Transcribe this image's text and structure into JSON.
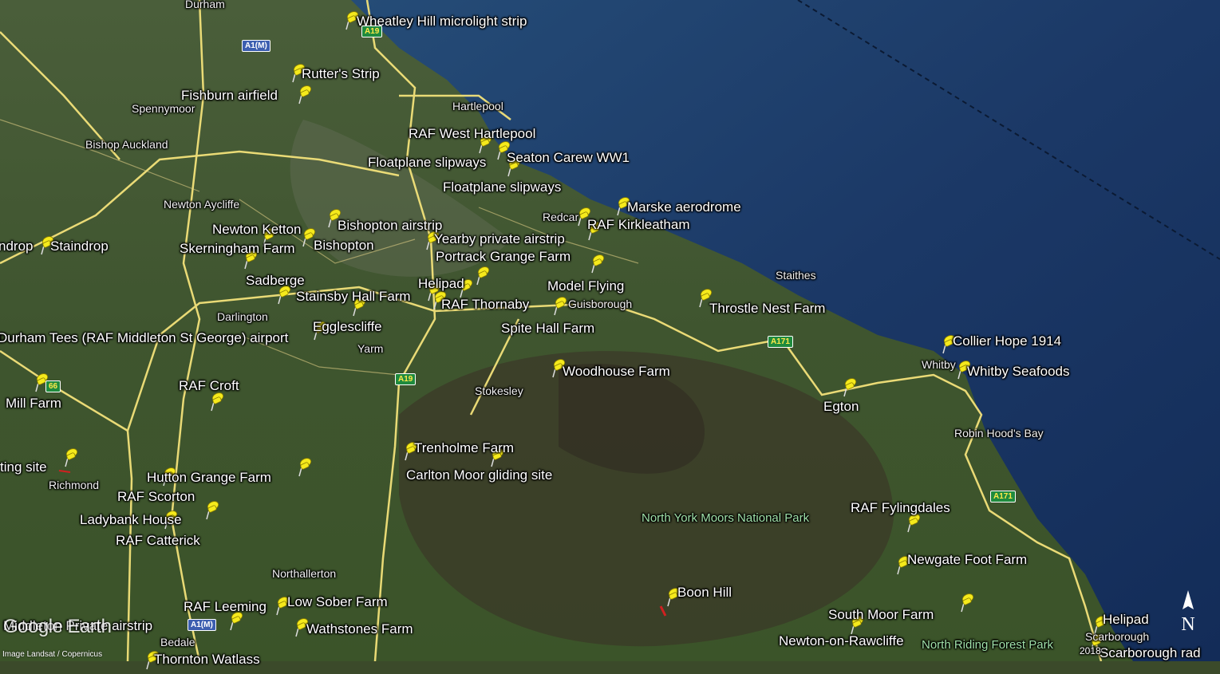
{
  "placemarks": [
    {
      "id": "wheatley-hill",
      "label": "Wheatley Hill microlight strip"
    },
    {
      "id": "rutters",
      "label": "Rutter's Strip"
    },
    {
      "id": "fishburn",
      "label": "Fishburn airfield"
    },
    {
      "id": "raf-west-hartlepool",
      "label": "RAF West Hartlepool"
    },
    {
      "id": "seaton-carew",
      "label": "Seaton Carew WW1"
    },
    {
      "id": "floatplane-1",
      "label": "Floatplane slipways"
    },
    {
      "id": "floatplane-2",
      "label": "Floatplane slipways"
    },
    {
      "id": "marske",
      "label": "Marske aerodrome"
    },
    {
      "id": "raf-kirkleatham",
      "label": "RAF Kirkleatham"
    },
    {
      "id": "bishopton-airstrip",
      "label": "Bishopton airstrip"
    },
    {
      "id": "newton-ketton",
      "label": "Newton Ketton"
    },
    {
      "id": "yearby",
      "label": "Yearby private airstrip"
    },
    {
      "id": "staindrop",
      "label": "Staindrop"
    },
    {
      "id": "skerningham",
      "label": "Skerningham Farm"
    },
    {
      "id": "bishopton",
      "label": "Bishopton"
    },
    {
      "id": "portrack",
      "label": "Portrack Grange Farm"
    },
    {
      "id": "sadberge",
      "label": "Sadberge"
    },
    {
      "id": "helipad-teesside",
      "label": "Helipad"
    },
    {
      "id": "model-flying",
      "label": "Model Flying"
    },
    {
      "id": "stainsby",
      "label": "Stainsby Hall Farm"
    },
    {
      "id": "raf-thornaby",
      "label": "RAF Thornaby"
    },
    {
      "id": "throstle",
      "label": "Throstle Nest Farm"
    },
    {
      "id": "spite-hall",
      "label": "Spite Hall Farm"
    },
    {
      "id": "egglescliffe",
      "label": "Egglescliffe"
    },
    {
      "id": "durham-tees",
      "label": "Durham Tees (RAF Middleton St George) airport"
    },
    {
      "id": "collier-hope",
      "label": "Collier Hope 1914"
    },
    {
      "id": "woodhouse",
      "label": "Woodhouse Farm"
    },
    {
      "id": "whitby-seafoods",
      "label": "Whitby Seafoods"
    },
    {
      "id": "raf-croft",
      "label": "RAF Croft"
    },
    {
      "id": "mill-farm",
      "label": "Mill Farm"
    },
    {
      "id": "egton",
      "label": "Egton"
    },
    {
      "id": "trenholme",
      "label": "Trenholme Farm"
    },
    {
      "id": "landing-site",
      "label": "ting site"
    },
    {
      "id": "carlton-moor",
      "label": "Carlton Moor gliding site"
    },
    {
      "id": "hutton-grange",
      "label": "Hutton Grange Farm"
    },
    {
      "id": "raf-scorton",
      "label": "RAF Scorton"
    },
    {
      "id": "raf-fylingdales",
      "label": "RAF Fylingdales"
    },
    {
      "id": "ladybank",
      "label": "Ladybank House"
    },
    {
      "id": "raf-catterick",
      "label": "RAF Catterick"
    },
    {
      "id": "newgate-foot",
      "label": "Newgate Foot Farm"
    },
    {
      "id": "boon-hill",
      "label": "Boon Hill"
    },
    {
      "id": "raf-leeming",
      "label": "RAF Leeming"
    },
    {
      "id": "low-sober",
      "label": "Low Sober Farm"
    },
    {
      "id": "south-moor",
      "label": "South Moor Farm"
    },
    {
      "id": "helipad-scarborough",
      "label": "Helipad"
    },
    {
      "id": "middleton-private",
      "label": "Middleton Private airstrip"
    },
    {
      "id": "wathstones",
      "label": "Wathstones Farm"
    },
    {
      "id": "thornton-watlass",
      "label": "Thornton Watlass"
    },
    {
      "id": "scarborough-radar",
      "label": "Scarborough rad"
    },
    {
      "id": "staindrop-left",
      "label": "ndrop"
    }
  ],
  "towns": [
    {
      "id": "durham",
      "label": "Durham"
    },
    {
      "id": "hartlepool",
      "label": "Hartlepool"
    },
    {
      "id": "spennymoor",
      "label": "Spennymoor"
    },
    {
      "id": "bishop-auckland",
      "label": "Bishop Auckland"
    },
    {
      "id": "newton-aycliffe",
      "label": "Newton Aycliffe"
    },
    {
      "id": "redcar",
      "label": "Redcar"
    },
    {
      "id": "darlington",
      "label": "Darlington"
    },
    {
      "id": "yarm",
      "label": "Yarm"
    },
    {
      "id": "guisborough",
      "label": "Guisborough"
    },
    {
      "id": "staithes",
      "label": "Staithes"
    },
    {
      "id": "stokesley",
      "label": "Stokesley"
    },
    {
      "id": "whitby",
      "label": "Whitby"
    },
    {
      "id": "robin-hoods-bay",
      "label": "Robin Hood's Bay"
    },
    {
      "id": "richmond",
      "label": "Richmond"
    },
    {
      "id": "northallerton",
      "label": "Northallerton"
    },
    {
      "id": "bedale",
      "label": "Bedale"
    },
    {
      "id": "newton-on-rawcliffe",
      "label": "Newton-on-Rawcliffe"
    },
    {
      "id": "scarborough",
      "label": "Scarborough"
    }
  ],
  "parks": [
    {
      "id": "nymnp",
      "label": "North York Moors National Park"
    },
    {
      "id": "nrfp",
      "label": "North Riding Forest Park"
    }
  ],
  "road_shields": [
    {
      "id": "a1m-top",
      "label": "A1(M)",
      "kind": "motorway"
    },
    {
      "id": "a19-top",
      "label": "A19",
      "kind": "primary"
    },
    {
      "id": "a171-mid",
      "label": "A171",
      "kind": "primary"
    },
    {
      "id": "a19-mid",
      "label": "A19",
      "kind": "primary"
    },
    {
      "id": "a66",
      "label": "66",
      "kind": "primary"
    },
    {
      "id": "a171-east",
      "label": "A171",
      "kind": "primary"
    },
    {
      "id": "a1m-bottom",
      "label": "A1(M)",
      "kind": "motorway"
    }
  ],
  "branding": {
    "logo": "Google Earth",
    "credit": "Image Landsat / Copernicus",
    "year": "2018",
    "compass": "N"
  },
  "colors": {
    "sea": "#1e3a63",
    "land": "#3d5330",
    "road": "#f3e27a",
    "pin": "#f5ea1c"
  }
}
